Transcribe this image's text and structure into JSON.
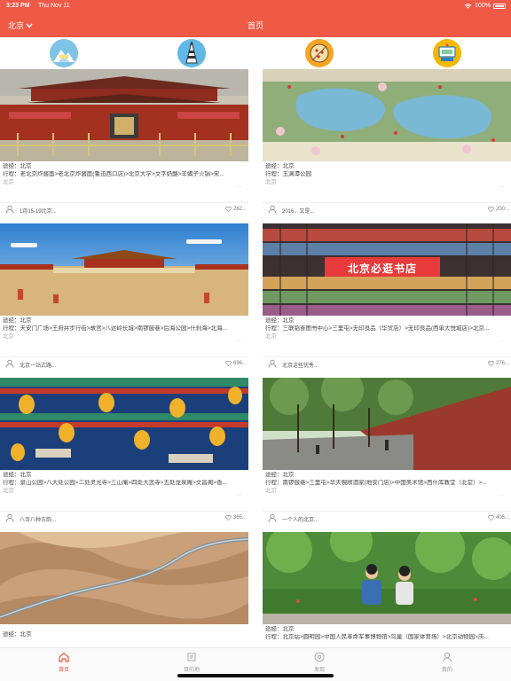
{
  "status": {
    "time": "3:23 PM",
    "date": "Thu Nov 11",
    "battery": "100%"
  },
  "nav": {
    "city": "北京",
    "city_icon": "chevron-down-icon",
    "title": "首页"
  },
  "categories": [
    {
      "icon": "travel-guide-icon"
    },
    {
      "icon": "landmark-icon"
    },
    {
      "icon": "food-icon"
    },
    {
      "icon": "hotel-icon"
    }
  ],
  "cards": [
    {
      "image": "tiananmen-gate-photo",
      "via": "途经：北京",
      "route": "行程：老北京炸酱面>老北京炸酱面(鲁迅西口店)>北京大学>文字奶酪>羊蝎子火锅>宋...",
      "tag": "北京",
      "more": "···",
      "title": "1月15-19北京...",
      "likes": "262..."
    },
    {
      "image": "yuyuantan-park-map-photo",
      "via": "途经：北京",
      "route": "行程：玉渊潭公园",
      "tag": "北京",
      "more": "···",
      "title": "2016，又是...",
      "likes": "200..."
    },
    {
      "image": "forbidden-city-courtyard-photo",
      "via": "途经：北京",
      "route": "行程：天安门广场>王府井步行街>故宫>八达岭长城>南锣鼓巷>后海公园>什刹海>北海...",
      "tag": "北京",
      "more": "···",
      "title": "北京一站式路...",
      "likes": "696..."
    },
    {
      "image": "bookstore-photo",
      "sign_text": "北京必逛书店",
      "via": "途经：北京",
      "route": "行程：三联韬奋图书中心>三里屯>无印良品（华贸店）>无印良品(西单大悦城店)>北京...",
      "tag": "北京",
      "more": "···",
      "title": "北京这些优秀...",
      "likes": "276..."
    },
    {
      "image": "temple-lanterns-photo",
      "via": "途经：北京",
      "route": "行程：景山公园>八大处公园>二处灵光寺>三山庵>四处大悲寺>五处龙泉庵>文昌阁>香...",
      "tag": "北京",
      "more": "···",
      "title": "八寺八种古韵...",
      "likes": "365..."
    },
    {
      "image": "red-wall-street-photo",
      "via": "途经：北京",
      "route": "行程：南锣鼓巷>三里屯>华天幌顺酒家(地安门店)>中国美术馆>西什库教堂（北堂）>...",
      "tag": "北京",
      "more": "···",
      "title": "一个人的北京...",
      "likes": "405..."
    },
    {
      "image": "great-wall-aerial-photo",
      "via": "途经：北京",
      "route": "",
      "tag": "",
      "more": "",
      "title": "",
      "likes": ""
    },
    {
      "image": "couple-in-park-photo",
      "via": "途经：北京",
      "route": "行程：北京站>圆明园>中国人民革命军事博物馆>鸟巢（国家体育场）>北京动物园>庆...",
      "tag": "",
      "more": "",
      "title": "",
      "likes": ""
    }
  ],
  "tabs": [
    {
      "label": "首页",
      "icon": "home-icon"
    },
    {
      "label": "目的地",
      "icon": "destination-icon"
    },
    {
      "label": "发现",
      "icon": "discover-icon"
    },
    {
      "label": "我的",
      "icon": "profile-icon"
    }
  ],
  "colors": {
    "accent": "#ef5a47",
    "tab_inactive": "#999999"
  }
}
